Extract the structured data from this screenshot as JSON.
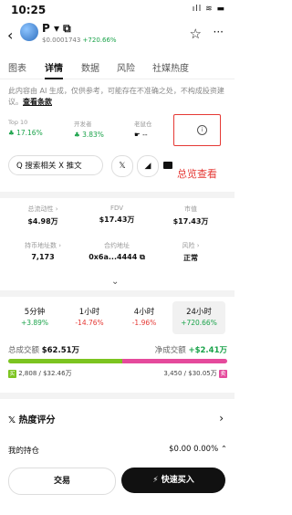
{
  "status": {
    "time": "10:25",
    "icons": "ıll ≋ ▬"
  },
  "header": {
    "back_icon": "‹",
    "name": "P ▾ ⧉",
    "price": "$0.0001743",
    "price_change": "+720.66%",
    "star_icon": "☆",
    "more_icon": "···"
  },
  "tabs": [
    "图表",
    "详情",
    "数据",
    "风险",
    "社媒热度"
  ],
  "active_tab": "详情",
  "disclaimer": {
    "text": "此内容由 AI 生成，仅供参考，可能存在不准确之处，不构成投资建议。",
    "link": "查看条款"
  },
  "top_stats": [
    {
      "label": "Top 10",
      "value": "♣ 17.16%"
    },
    {
      "label": "开发者",
      "value": "♣ 3.83%"
    },
    {
      "label": "老鼠仓",
      "value": "☛ --"
    }
  ],
  "overview_note": "总览查看",
  "search": {
    "label": "Q 搜索相关 X 推文"
  },
  "social": {
    "x": "𝕏",
    "telegram": "◢"
  },
  "metrics_row1": [
    {
      "label": "总流动性 ›",
      "value": "$4.98万"
    },
    {
      "label": "FDV",
      "value": "$17.43万"
    },
    {
      "label": "市值",
      "value": "$17.43万"
    }
  ],
  "metrics_row2": [
    {
      "label": "持币地址数 ›",
      "value": "7,173"
    },
    {
      "label": "合约地址",
      "value": "0x6a...4444 ⧉"
    },
    {
      "label": "风险 ›",
      "value": "正常"
    }
  ],
  "expand_icon": "⌄",
  "timeframes": [
    {
      "label": "5分钟",
      "value": "+3.89%",
      "color": "green"
    },
    {
      "label": "1小时",
      "value": "-14.76%",
      "color": "red"
    },
    {
      "label": "4小时",
      "value": "-1.96%",
      "color": "red"
    },
    {
      "label": "24小时",
      "value": "+720.66%",
      "color": "green"
    }
  ],
  "volume": {
    "total_label": "总成交额",
    "total_value": "$62.51万",
    "net_label": "净成交额",
    "net_value": "+$2.41万",
    "buy_text": "2,808 / $32.46万",
    "sell_text": "3,450 / $30.05万",
    "buy_tag": "买",
    "sell_tag": "卖",
    "buy_ratio": 0.52
  },
  "heat": {
    "label": "𝕏 热度评分",
    "chevron": "›"
  },
  "holdings": {
    "label": "我的持仓",
    "value": "$0.00 0.00% ⌃"
  },
  "actions": {
    "trade": "交易",
    "buy": "⚡ 快速买入"
  }
}
